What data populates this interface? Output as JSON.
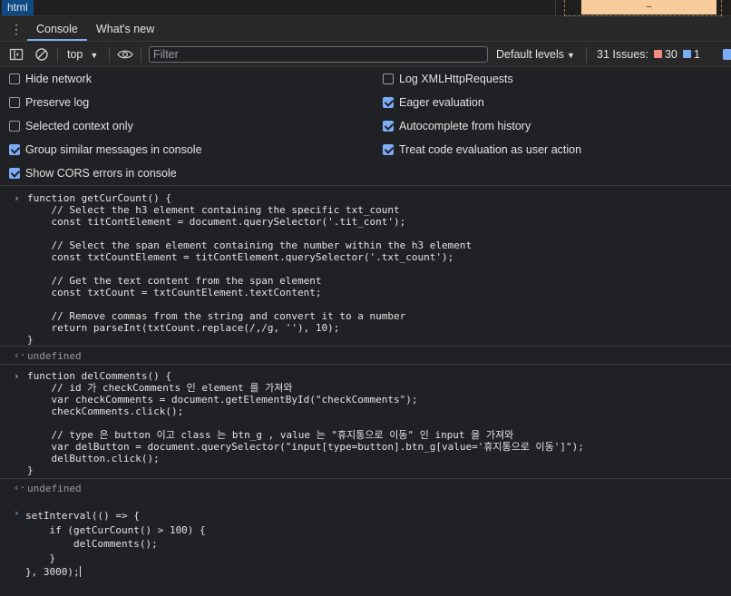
{
  "topstrip": {
    "breadcrumb": "html",
    "box_model_value": "–"
  },
  "tabs": {
    "menu_icon": "more-vert-icon",
    "console": "Console",
    "whats_new": "What's new"
  },
  "toolbar": {
    "context": "top",
    "filter_placeholder": "Filter",
    "levels": "Default levels",
    "issues_label": "31 Issues:",
    "issues_errors": "30",
    "issues_info": "1"
  },
  "settings": {
    "left": [
      {
        "label": "Hide network",
        "checked": false
      },
      {
        "label": "Preserve log",
        "checked": false
      },
      {
        "label": "Selected context only",
        "checked": false
      },
      {
        "label": "Group similar messages in console",
        "checked": true
      },
      {
        "label": "Show CORS errors in console",
        "checked": true
      }
    ],
    "right": [
      {
        "label": "Log XMLHttpRequests",
        "checked": false
      },
      {
        "label": "Eager evaluation",
        "checked": true
      },
      {
        "label": "Autocomplete from history",
        "checked": true
      },
      {
        "label": "Treat code evaluation as user action",
        "checked": true
      }
    ]
  },
  "console": {
    "entry1_code": "function getCurCount() {\n    // Select the h3 element containing the specific txt_count\n    const titContElement = document.querySelector('.tit_cont');\n\n    // Select the span element containing the number within the h3 element\n    const txtCountElement = titContElement.querySelector('.txt_count');\n\n    // Get the text content from the span element\n    const txtCount = txtCountElement.textContent;\n\n    // Remove commas from the string and convert it to a number\n    return parseInt(txtCount.replace(/,/g, ''), 10);\n}",
    "result1": "undefined",
    "entry2_code": "function delComments() {\n    // id 가 checkComments 인 element 를 가져와\n    var checkComments = document.getElementById(\"checkComments\");\n    checkComments.click();\n\n    // type 은 button 이고 class 는 btn_g , value 는 \"휴지통으로 이동\" 인 input 을 가져와\n    var delButton = document.querySelector(\"input[type=button].btn_g[value='휴지통으로 이동']\");\n    delButton.click();\n}",
    "result2": "undefined",
    "input_code": "setInterval(() => {\n    if (getCurCount() > 100) {\n        delComments();\n    }\n}, 3000);"
  },
  "colors": {
    "accent": "#7cacf8",
    "error": "#f28b82",
    "background": "#202124"
  }
}
